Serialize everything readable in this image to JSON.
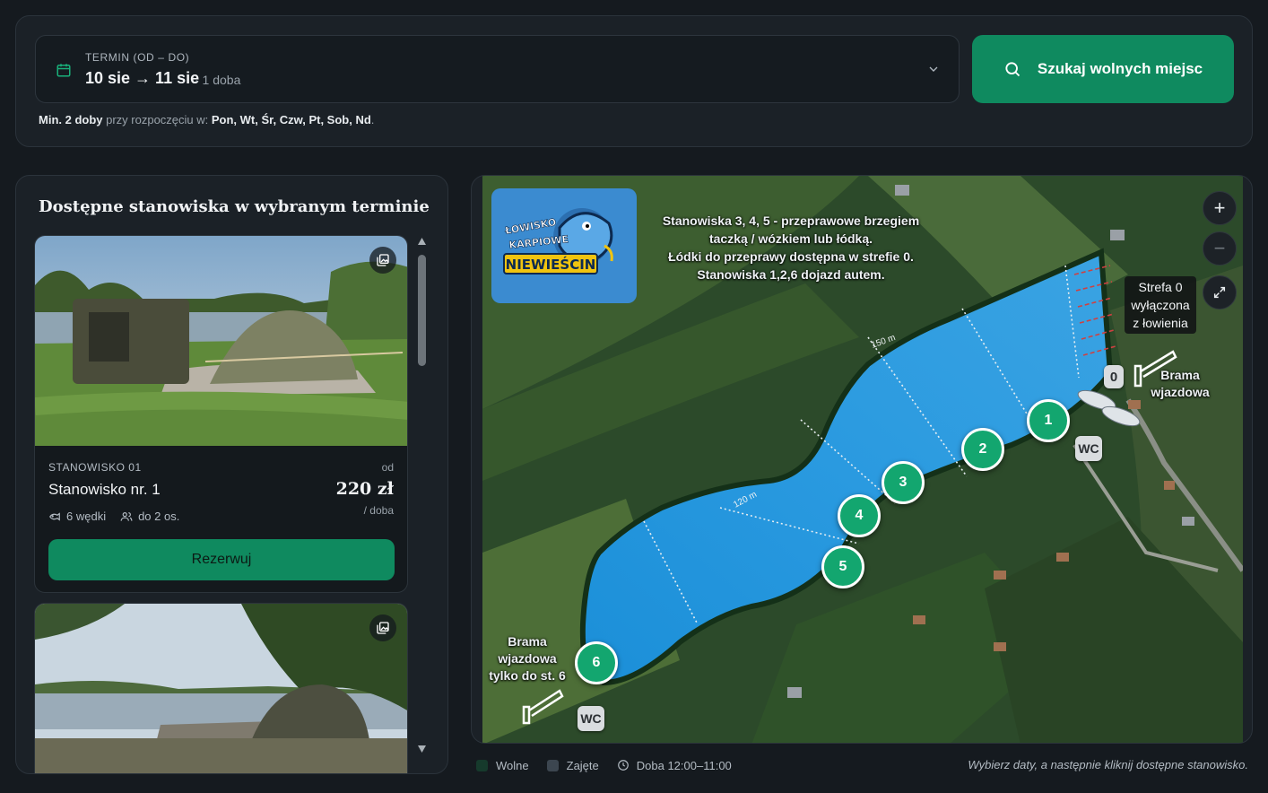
{
  "search": {
    "date_label": "TERMIN (OD – DO)",
    "date_value": "10 sie → 11 sie",
    "nights": "· 1 doba",
    "button_label": "Szukaj wolnych miejsc",
    "note_min": "Min. 2 doby",
    "note_mid": " przy rozpoczęciu w: ",
    "note_days": "Pon, Wt, Śr, Czw, Pt, Sob, Nd",
    "note_end": "."
  },
  "list": {
    "title": "Dostępne stanowiska w wybranym terminie",
    "cards": [
      {
        "code": "STANOWISKO 01",
        "from": "od",
        "name": "Stanowisko nr. 1",
        "price": "220 zł",
        "per": "/ doba",
        "rods": "6 wędki",
        "people": "do 2 os.",
        "button": "Rezerwuj"
      }
    ]
  },
  "map": {
    "logo_line1": "ŁOWISKO",
    "logo_line2": "KARPIOWE",
    "logo_line3": "NIEWIEŚCIN",
    "note": [
      "Stanowiska 3, 4, 5 -  przeprawowe brzegiem",
      "taczką / wózkiem lub łódką.",
      "Łódki do przeprawy dostępna w strefie 0.",
      "Stanowiska 1,2,6 dojazd autem."
    ],
    "zoom_in": "+",
    "zoom_out": "−",
    "zone0": [
      "Strefa 0",
      "wyłączona",
      "z łowienia"
    ],
    "zone0_badge": "0",
    "gate_east": [
      "Brama",
      "wjazdowa"
    ],
    "gate_west": [
      "Brama",
      "wjazdowa",
      "tylko do st. 6"
    ],
    "wc": "WC",
    "distance_1": "150 m",
    "distance_2": "120 m",
    "spots": [
      "1",
      "2",
      "3",
      "4",
      "5",
      "6"
    ]
  },
  "legend": {
    "free": "Wolne",
    "taken": "Zajęte",
    "day": "Doba 12:00–11:00",
    "hint": "Wybierz daty, a następnie kliknij dostępne stanowisko."
  },
  "colors": {
    "accent": "#0f8a5f",
    "spot": "#13a66f",
    "free": "#163a2c",
    "taken": "#3c4650"
  }
}
